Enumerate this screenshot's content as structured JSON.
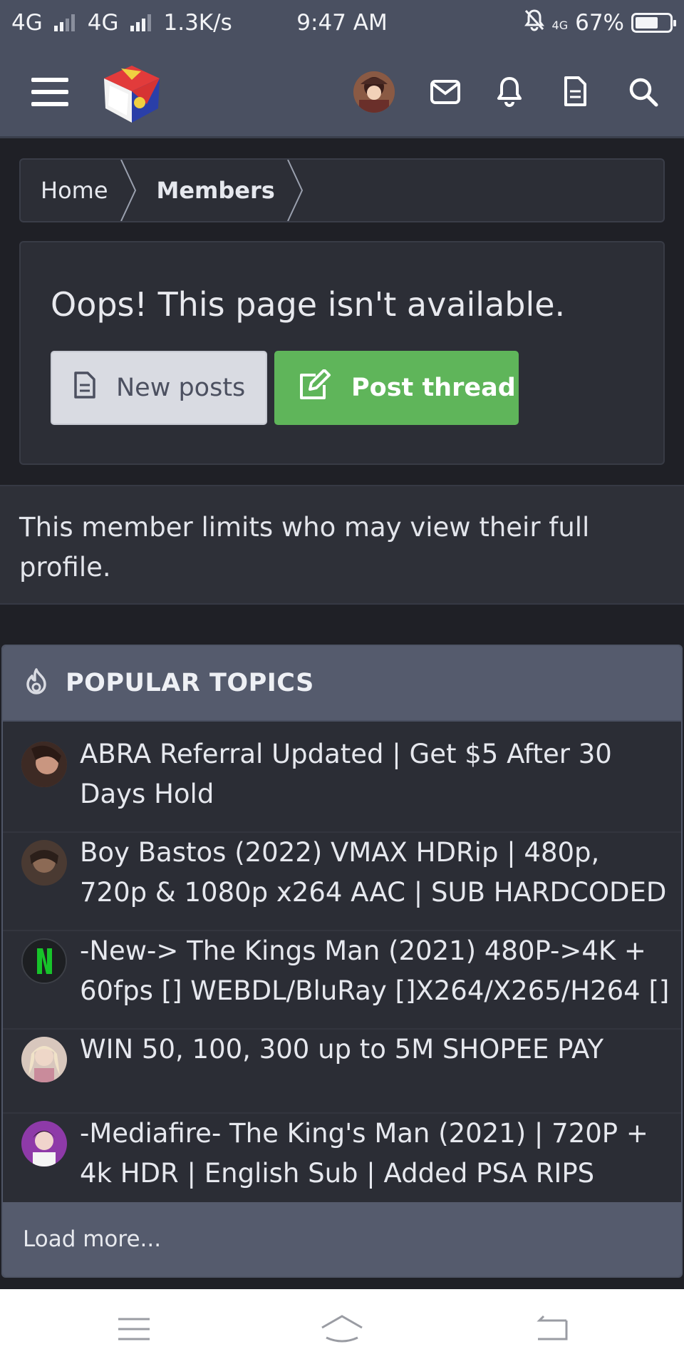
{
  "status_bar": {
    "network1": "4G",
    "network2": "4G",
    "speed": "1.3K/s",
    "time": "9:47 AM",
    "mini_network": "4G",
    "battery": "67%",
    "battery_level": 0.67
  },
  "header": {
    "menu_icon": "hamburger-icon",
    "logo_icon": "cube-logo",
    "avatar_icon": "user-avatar",
    "icons": [
      "mail-icon",
      "bell-icon",
      "document-icon",
      "search-icon"
    ]
  },
  "breadcrumb": {
    "items": [
      {
        "label": "Home"
      },
      {
        "label": "Members"
      }
    ]
  },
  "notice": {
    "title": "Oops! This page isn't available.",
    "new_posts_label": "New posts",
    "post_thread_label": "Post thread"
  },
  "restricted": {
    "message": "This member limits who may view their full profile."
  },
  "popular": {
    "title": "POPULAR TOPICS",
    "topics": [
      {
        "title": "ABRA Referral Updated | Get $5 After 30 Days Hold"
      },
      {
        "title": "Boy Bastos (2022) VMAX HDRip | 480p, 720p & 1080p x264 AAC | SUB HARDCODED"
      },
      {
        "title": "-New-> The Kings Man (2021) 480P->4K + 60fps [] WEBDL/BluRay []X264/X265/H264 []"
      },
      {
        "title": "WIN 50, 100, 300 up to 5M SHOPEE PAY"
      },
      {
        "title": "-Mediafire- The King's Man (2021) | 720P + 4k HDR | English Sub | Added PSA RIPS"
      }
    ],
    "load_more": "Load more..."
  },
  "colors": {
    "header_bg": "#4a5061",
    "page_bg": "#1f2026",
    "panel_bg": "#2c2e36",
    "post_thread_green": "#5fb55a",
    "new_posts_bg": "#d9dbe2"
  }
}
